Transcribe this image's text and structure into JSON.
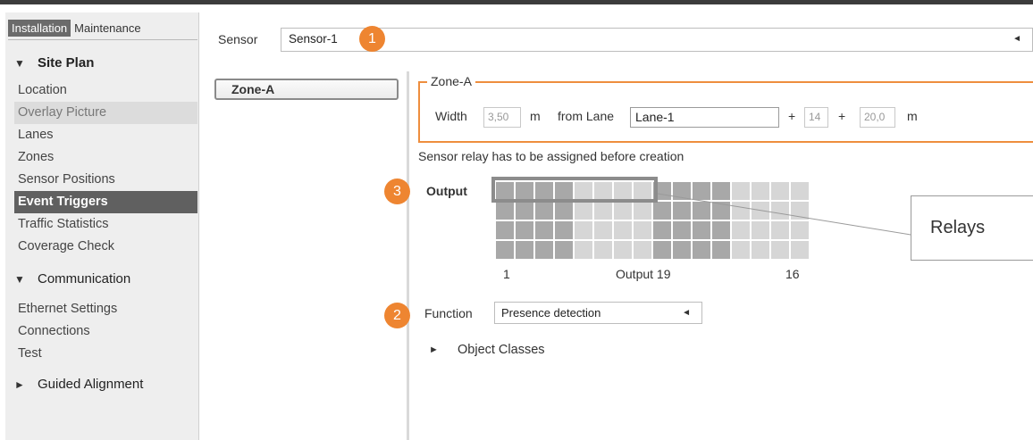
{
  "sidebar": {
    "tabs": [
      {
        "label": "Installation"
      },
      {
        "label": "Maintenance"
      }
    ],
    "sections": [
      {
        "title": "Site Plan",
        "items": [
          {
            "label": "Location"
          },
          {
            "label": "Overlay Picture"
          },
          {
            "label": "Lanes"
          },
          {
            "label": "Zones"
          },
          {
            "label": "Sensor Positions"
          },
          {
            "label": "Event Triggers"
          },
          {
            "label": "Traffic Statistics"
          },
          {
            "label": "Coverage Check"
          }
        ]
      },
      {
        "title": "Communication",
        "items": [
          {
            "label": "Ethernet Settings"
          },
          {
            "label": "Connections"
          },
          {
            "label": "Test"
          }
        ]
      },
      {
        "title": "Guided Alignment",
        "items": []
      }
    ],
    "icons": {
      "expanded": "▼",
      "collapsed": "►"
    }
  },
  "sensor": {
    "label": "Sensor",
    "value": "Sensor-1",
    "arrow": "◄"
  },
  "badges": [
    "1",
    "2",
    "3"
  ],
  "zone_list": {
    "items": [
      {
        "label": "Zone-A"
      }
    ]
  },
  "zone": {
    "title": "Zone-A",
    "width_label": "Width",
    "width_value": "3,50",
    "unit_m": "m",
    "from_lane_label": "from Lane",
    "lane_value": "Lane-1",
    "plus": "+",
    "offset_value": "14",
    "distance_value": "20,0"
  },
  "relay_note": "Sensor relay has to be assigned before creation",
  "output": {
    "label": "Output",
    "grid_rows": [
      "DDDDLLLLDDDDLLLL",
      "DDDDLLLLDDDDLLLL",
      "DDDDLLLLDDDDLLLL",
      "DDDDLLLLDDDDLLLL"
    ],
    "axis_start": "1",
    "axis_hover": "Output 19",
    "axis_end": "16"
  },
  "callout": {
    "label": "Relays"
  },
  "function": {
    "label": "Function",
    "value": "Presence detection",
    "arrow": "◄"
  },
  "object_classes": {
    "label": "Object Classes",
    "icon": "►"
  },
  "colors": {
    "accent": "#ee8531",
    "frame": "#ee8e3e",
    "active_item": "#606060",
    "relay_dark": "#a8a8a8",
    "relay_light": "#d6d6d6"
  }
}
